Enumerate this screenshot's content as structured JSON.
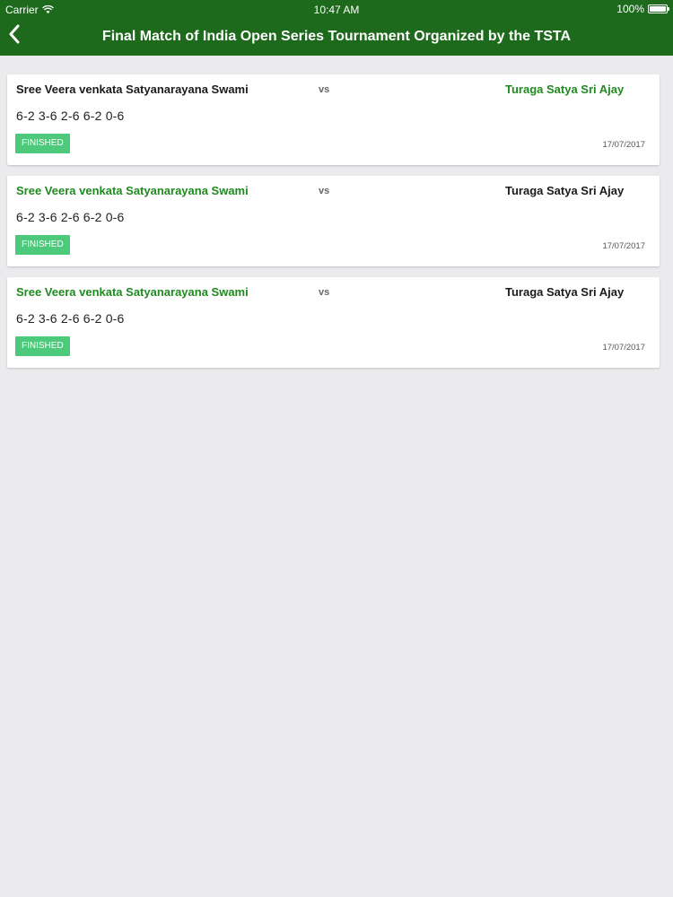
{
  "status_bar": {
    "carrier": "Carrier",
    "time": "10:47 AM",
    "battery": "100%",
    "battery_level": 1.0
  },
  "nav": {
    "back_icon": "chevron-left-icon",
    "title": "Final Match of India Open Series Tournament Organized by the TSTA"
  },
  "colors": {
    "header_bg": "#1d6a1d",
    "winner_text": "#1f8a1f",
    "badge_bg": "#4cc97a",
    "page_bg": "#ebebed"
  },
  "matches": [
    {
      "player1": "Sree Veera venkata Satyanarayana Swami",
      "vs": "vs",
      "player2": "Turaga Satya Sri Ajay",
      "winner": "player2",
      "score": "6-2 3-6 2-6 6-2 0-6",
      "status": "FINISHED",
      "date": "17/07/2017"
    },
    {
      "player1": "Sree Veera venkata Satyanarayana Swami",
      "vs": "vs",
      "player2": "Turaga Satya Sri Ajay",
      "winner": "player1",
      "score": "6-2 3-6 2-6 6-2 0-6",
      "status": "FINISHED",
      "date": "17/07/2017"
    },
    {
      "player1": "Sree Veera venkata Satyanarayana Swami",
      "vs": "vs",
      "player2": "Turaga Satya Sri Ajay",
      "winner": "player1",
      "score": "6-2 3-6 2-6 6-2 0-6",
      "status": "FINISHED",
      "date": "17/07/2017"
    }
  ]
}
